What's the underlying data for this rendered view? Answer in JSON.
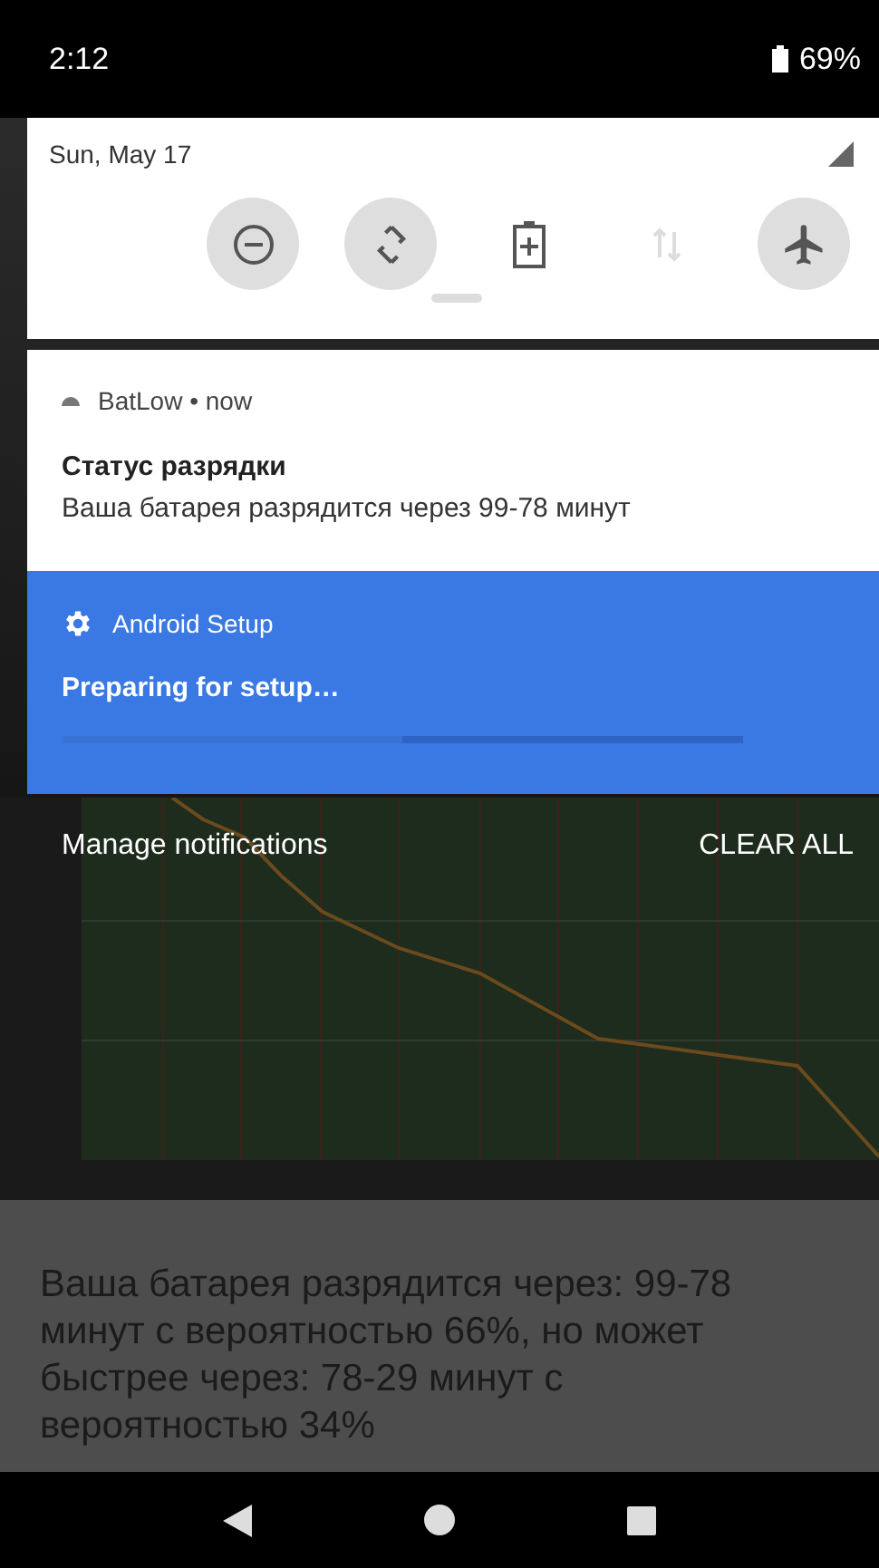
{
  "status_bar": {
    "time": "2:12",
    "battery": "69%"
  },
  "quick_settings": {
    "date": "Sun, May 17",
    "tiles": [
      {
        "kind": "dnd",
        "on": true
      },
      {
        "kind": "rotate",
        "on": true
      },
      {
        "kind": "battery_saver",
        "on": false
      },
      {
        "kind": "data",
        "on": false
      },
      {
        "kind": "airplane",
        "on": true
      }
    ]
  },
  "notifications": [
    {
      "kind": "plain",
      "app": "BatLow",
      "separator": "•",
      "time": "now",
      "title": "Статус разрядки",
      "text": "Ваша батарея разрядится через 99-78 минут"
    },
    {
      "kind": "progress",
      "app": "Android Setup",
      "title": "Preparing for setup…",
      "level": 0.5
    }
  ],
  "footer": {
    "manage": "Manage notifications",
    "clear": "CLEAR ALL"
  },
  "background_app": {
    "message": "Ваша батарея разрядится через: 99-78 минут с вероятностью 66%, но может быстрее через: 78-29 минут с вероятностью 34%"
  }
}
